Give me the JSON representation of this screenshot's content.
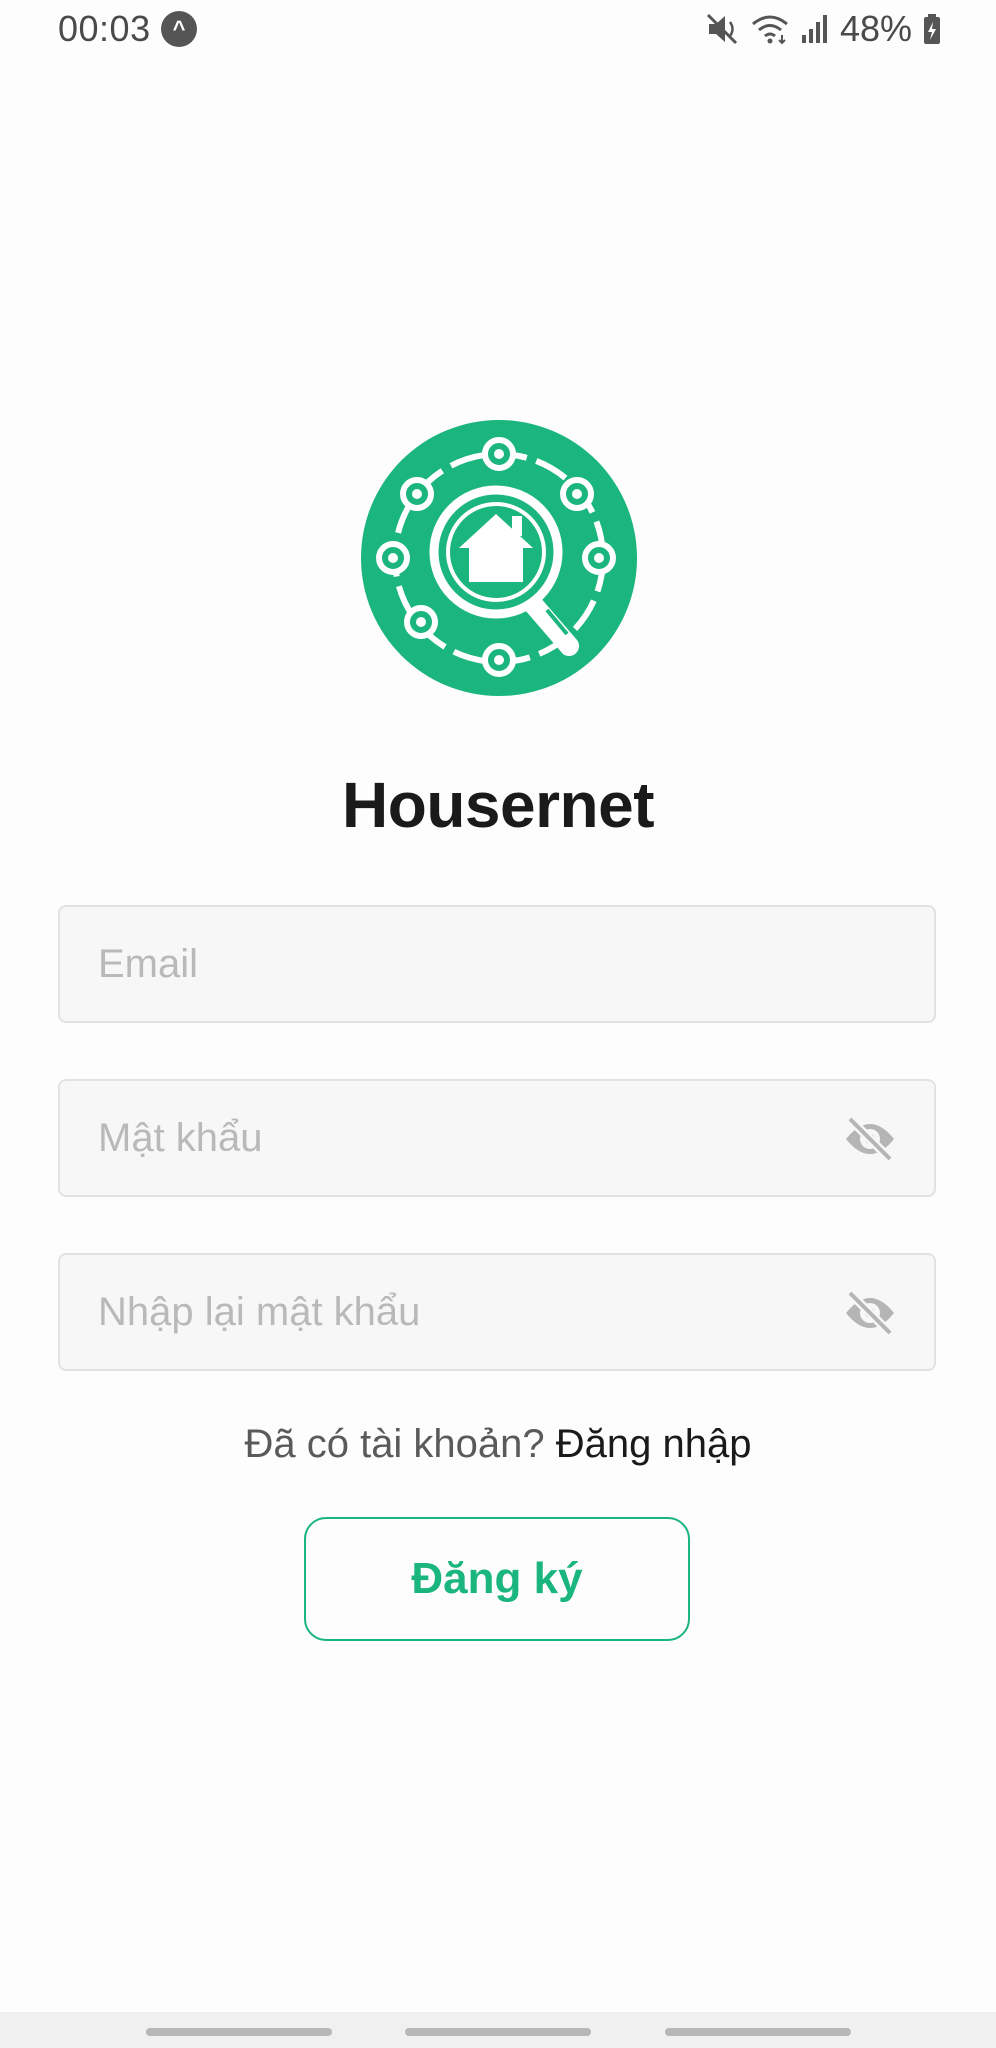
{
  "status_bar": {
    "time": "00:03",
    "app_icon_glyph": "^",
    "battery": "48%",
    "icons": [
      "mute-icon",
      "wifi-icon",
      "signal-icon",
      "battery-icon"
    ]
  },
  "app": {
    "title": "Housernet",
    "logo_icon": "house-search-network-logo",
    "accent_color": "#1bb57e"
  },
  "form": {
    "email": {
      "placeholder": "Email",
      "value": ""
    },
    "password": {
      "placeholder": "Mật khẩu",
      "value": "",
      "toggle_icon": "eye-off-icon"
    },
    "confirm_password": {
      "placeholder": "Nhập lại mật khẩu",
      "value": "",
      "toggle_icon": "eye-off-icon"
    },
    "signin_prompt": "Đã có tài khoản?",
    "signin_link": "Đăng nhập",
    "register_label": "Đăng ký"
  },
  "nav_bar": {
    "items": [
      "recent-apps",
      "home",
      "back"
    ]
  }
}
